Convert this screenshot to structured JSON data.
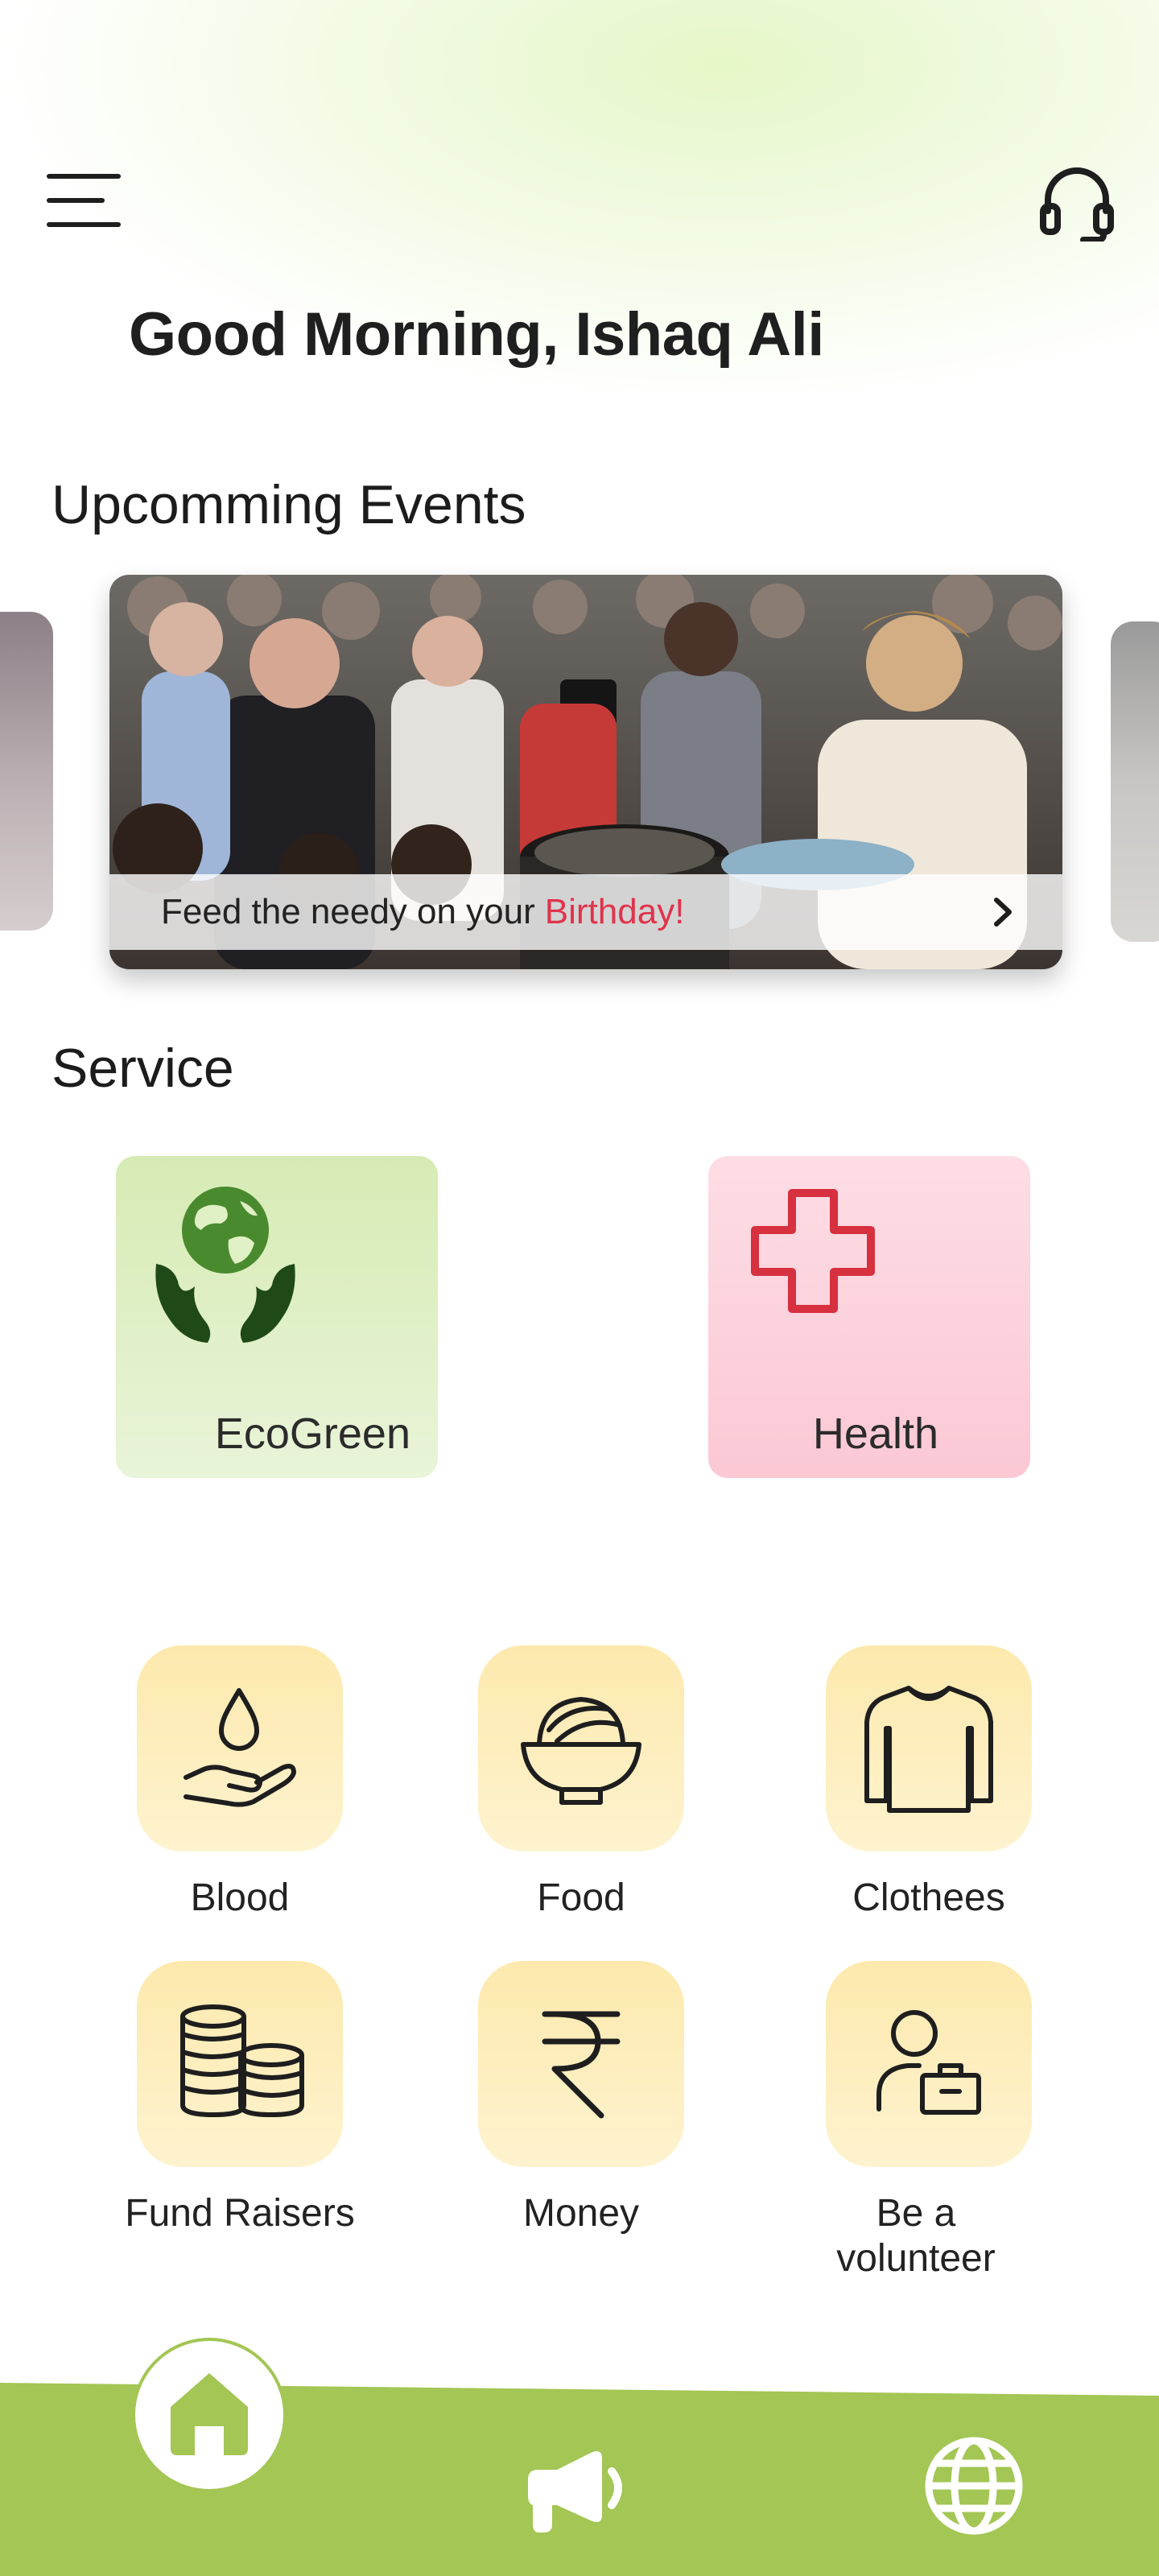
{
  "header": {
    "greeting": "Good Morning, Ishaq Ali",
    "menu_icon": "hamburger-menu-icon",
    "support_icon": "headset-icon"
  },
  "events": {
    "title": "Upcomming Events",
    "featured": {
      "caption_prefix": "Feed the needy on your",
      "caption_highlight": "Birthday!"
    }
  },
  "service": {
    "title": "Service",
    "featured": [
      {
        "label": "EcoGreen",
        "icon": "globe-in-hands-icon"
      },
      {
        "label": "Health",
        "icon": "medical-cross-icon"
      }
    ],
    "items": [
      {
        "label": "Blood",
        "icon": "blood-drop-hand-icon"
      },
      {
        "label": "Food",
        "icon": "food-bowl-icon"
      },
      {
        "label": "Clothees",
        "icon": "sweater-icon"
      },
      {
        "label": "Fund Raisers",
        "icon": "coins-stack-icon"
      },
      {
        "label": "Money",
        "icon": "rupee-icon"
      },
      {
        "label": "Be a volunteer",
        "icon": "volunteer-icon"
      }
    ]
  },
  "bottom_nav": {
    "items": [
      {
        "name": "home",
        "icon": "home-icon",
        "active": true
      },
      {
        "name": "announcements",
        "icon": "megaphone-icon",
        "active": false
      },
      {
        "name": "globe",
        "icon": "globe-icon",
        "active": false
      }
    ]
  },
  "colors": {
    "accent_green": "#a3c654",
    "highlight_red": "#e0334c",
    "eco_card": "#dcefc0",
    "health_card": "#fcd3dd",
    "tile_yellow": "#fdeeb9"
  }
}
